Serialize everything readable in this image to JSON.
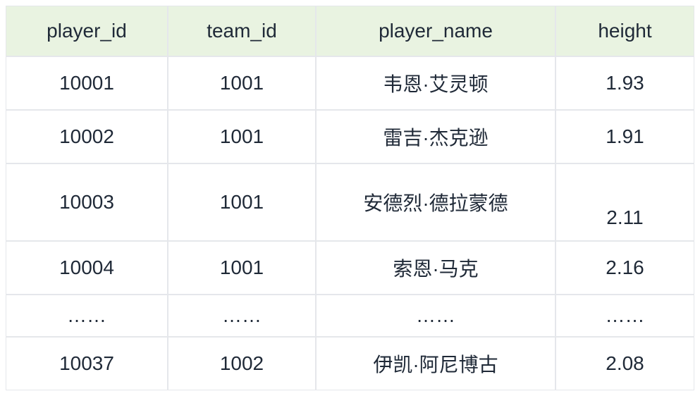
{
  "table": {
    "headers": {
      "player_id": "player_id",
      "team_id": "team_id",
      "player_name": "player_name",
      "height": "height"
    },
    "rows": [
      {
        "player_id": "10001",
        "team_id": "1001",
        "player_name": "韦恩·艾灵顿",
        "height": "1.93"
      },
      {
        "player_id": "10002",
        "team_id": "1001",
        "player_name": "雷吉·杰克逊",
        "height": "1.91"
      },
      {
        "player_id": "10003",
        "team_id": "1001",
        "player_name": "安德烈·德拉蒙德",
        "height": "2.11"
      },
      {
        "player_id": "10004",
        "team_id": "1001",
        "player_name": "索恩·马克",
        "height": "2.16"
      },
      {
        "player_id": "……",
        "team_id": "……",
        "player_name": "……",
        "height": "……"
      },
      {
        "player_id": "10037",
        "team_id": "1002",
        "player_name": "伊凯·阿尼博古",
        "height": "2.08"
      }
    ]
  }
}
